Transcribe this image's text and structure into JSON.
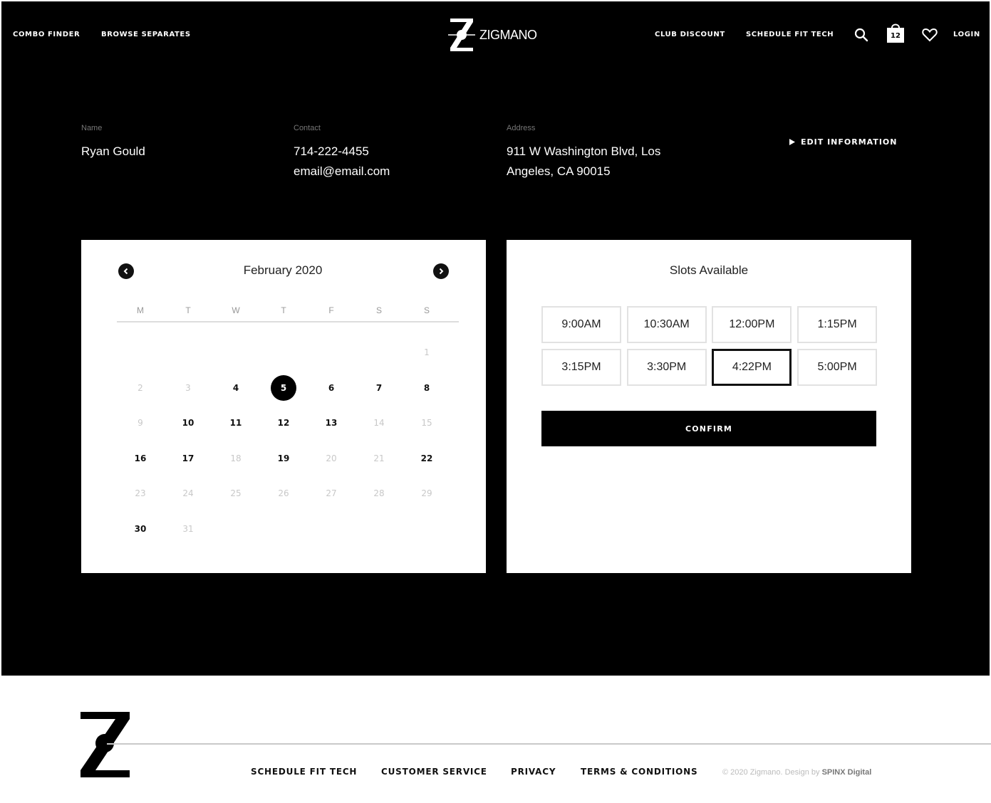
{
  "header": {
    "nav_left": [
      "COMBO FINDER",
      "BROWSE SEPARATES"
    ],
    "brand": "ZIGMANO",
    "nav_right": [
      "CLUB DISCOUNT",
      "SCHEDULE FIT TECH"
    ],
    "cart_count": "12",
    "login": "LOGIN",
    "icons": [
      "search-icon",
      "cart-icon",
      "heart-icon"
    ]
  },
  "info": {
    "name_label": "Name",
    "name_value": "Ryan Gould",
    "contact_label": "Contact",
    "contact_phone": "714-222-4455",
    "contact_email": "email@email.com",
    "address_label": "Address",
    "address_line1": "911 W Washington Blvd, Los",
    "address_line2": "Angeles, CA 90015",
    "edit_label": "EDIT INFORMATION"
  },
  "calendar": {
    "title": "February 2020",
    "weekdays": [
      "M",
      "T",
      "W",
      "T",
      "F",
      "S",
      "S"
    ],
    "selected_day": "5",
    "weeks": [
      [
        null,
        null,
        null,
        null,
        null,
        null,
        {
          "d": "1",
          "muted": true
        }
      ],
      [
        {
          "d": "2",
          "muted": true
        },
        {
          "d": "3",
          "muted": true
        },
        {
          "d": "4"
        },
        {
          "d": "5",
          "selected": true
        },
        {
          "d": "6"
        },
        {
          "d": "7"
        },
        {
          "d": "8"
        }
      ],
      [
        {
          "d": "9",
          "muted": true
        },
        {
          "d": "10"
        },
        {
          "d": "11"
        },
        {
          "d": "12"
        },
        {
          "d": "13"
        },
        {
          "d": "14",
          "muted": true
        },
        {
          "d": "15",
          "muted": true
        }
      ],
      [
        {
          "d": "16"
        },
        {
          "d": "17"
        },
        {
          "d": "18",
          "muted": true
        },
        {
          "d": "19"
        },
        {
          "d": "20",
          "muted": true
        },
        {
          "d": "21",
          "muted": true
        },
        {
          "d": "22"
        }
      ],
      [
        {
          "d": "23",
          "muted": true
        },
        {
          "d": "24",
          "muted": true
        },
        {
          "d": "25",
          "muted": true
        },
        {
          "d": "26",
          "muted": true
        },
        {
          "d": "27",
          "muted": true
        },
        {
          "d": "28",
          "muted": true
        },
        {
          "d": "29",
          "muted": true
        }
      ],
      [
        {
          "d": "30"
        },
        {
          "d": "31",
          "muted": true
        },
        null,
        null,
        null,
        null,
        null
      ]
    ]
  },
  "slots": {
    "title": "Slots Available",
    "times": [
      "9:00AM",
      "10:30AM",
      "12:00PM",
      "1:15PM",
      "3:15PM",
      "3:30PM",
      "4:22PM",
      "5:00PM"
    ],
    "selected": "4:22PM",
    "confirm_label": "CONFIRM"
  },
  "footer": {
    "links": [
      "SCHEDULE FIT TECH",
      "CUSTOMER SERVICE",
      "PRIVACY",
      "TERMS & CONDITIONS"
    ],
    "copyright_prefix": "© 2020 Zigmano. Design by",
    "copyright_brand": "SPINX Digital"
  },
  "colors": {
    "background": "#000000",
    "surface": "#ffffff",
    "accent": "#000000",
    "muted_text": "#c8c8c8"
  }
}
